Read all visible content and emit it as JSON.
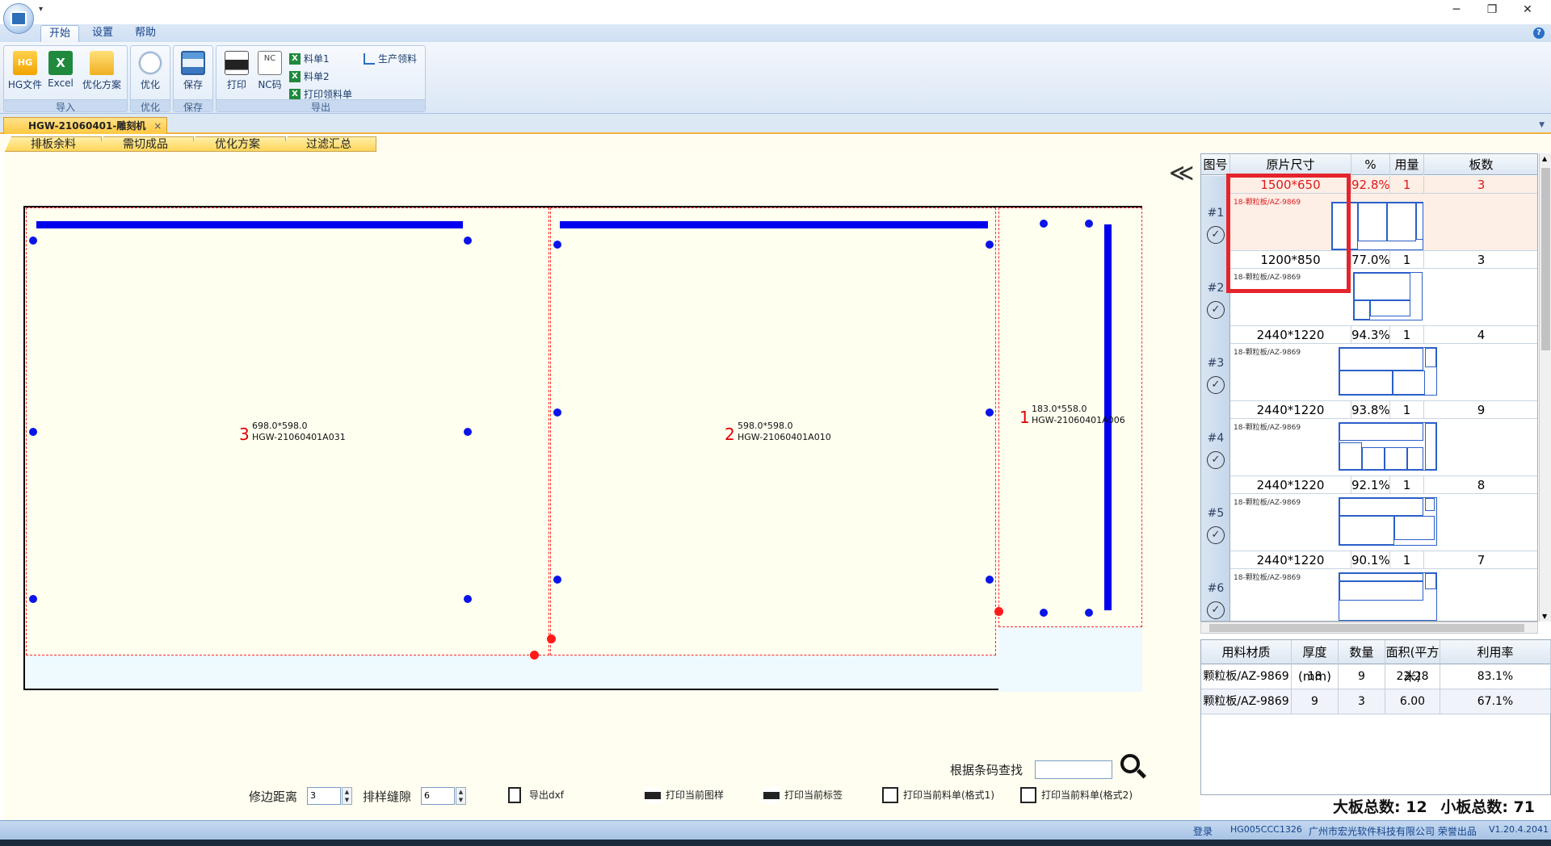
{
  "menu": {
    "tabs": [
      "开始",
      "设置",
      "帮助"
    ]
  },
  "ribbon": {
    "groups": [
      "导入",
      "优化",
      "保存",
      "导出"
    ],
    "hg_label": "HG文件",
    "hg_icon": "HG",
    "excel_label": "Excel",
    "excel_icon": "X",
    "plan_label": "优化方案",
    "optimize_label": "优化",
    "save_label": "保存",
    "print_label": "打印",
    "nc_label": "NC码",
    "nc_icon": "NC",
    "list1": "料单1",
    "list2": "料单2",
    "print_pick": "打印领料单",
    "production": "生产领料"
  },
  "doc_tab": {
    "title": "HGW-21060401-雕刻机",
    "close": "×"
  },
  "sub_tabs": [
    "排板余料",
    "需切成品",
    "优化方案",
    "过滤汇总"
  ],
  "collapse_glyph": "≪",
  "parts": [
    {
      "num": "3",
      "size": "698.0*598.0",
      "code": "HGW-21060401A031"
    },
    {
      "num": "2",
      "size": "598.0*598.0",
      "code": "HGW-21060401A010"
    },
    {
      "num": "1",
      "size": "183.0*558.0",
      "code": "HGW-21060401A006"
    }
  ],
  "controls": {
    "trim_label": "修边距离",
    "trim_value": "3",
    "gap_label": "排样缝隙",
    "gap_value": "6",
    "export_dxf": "导出dxf",
    "print_pattern": "打印当前图样",
    "print_label": "打印当前标签",
    "print_list1": "打印当前料单(格式1)",
    "print_list2": "打印当前料单(格式2)",
    "search_label": "根据条码查找"
  },
  "sheet_list": {
    "headers": [
      "图号",
      "原片尺寸",
      "%",
      "用量",
      "板数"
    ],
    "rows": [
      {
        "id": "#1",
        "size": "1500*650",
        "pct": "92.8%",
        "qty": "1",
        "boards": "3",
        "material": "18-颗粒板/AZ-9869"
      },
      {
        "id": "#2",
        "size": "1200*850",
        "pct": "77.0%",
        "qty": "1",
        "boards": "3",
        "material": "18-颗粒板/AZ-9869"
      },
      {
        "id": "#3",
        "size": "2440*1220",
        "pct": "94.3%",
        "qty": "1",
        "boards": "4",
        "material": "18-颗粒板/AZ-9869"
      },
      {
        "id": "#4",
        "size": "2440*1220",
        "pct": "93.8%",
        "qty": "1",
        "boards": "9",
        "material": "18-颗粒板/AZ-9869"
      },
      {
        "id": "#5",
        "size": "2440*1220",
        "pct": "92.1%",
        "qty": "1",
        "boards": "8",
        "material": "18-颗粒板/AZ-9869"
      },
      {
        "id": "#6",
        "size": "2440*1220",
        "pct": "90.1%",
        "qty": "1",
        "boards": "7",
        "material": "18-颗粒板/AZ-9869"
      }
    ]
  },
  "summary": {
    "headers": [
      "用料材质",
      "厚度(mm)",
      "数量",
      "面积(平方米)",
      "利用率"
    ],
    "rows": [
      [
        "颗粒板/AZ-9869",
        "18",
        "9",
        "22.28",
        "83.1%"
      ],
      [
        "颗粒板/AZ-9869",
        "9",
        "3",
        "6.00",
        "67.1%"
      ]
    ]
  },
  "totals": {
    "big_label": "大板总数:",
    "big_value": "12",
    "small_label": "小板总数:",
    "small_value": "71"
  },
  "status": {
    "login": "登录",
    "code": "HG005CCC1326",
    "company": "广州市宏光软件科技有限公司 荣誉出品",
    "version": "V1.20.4.2041"
  }
}
